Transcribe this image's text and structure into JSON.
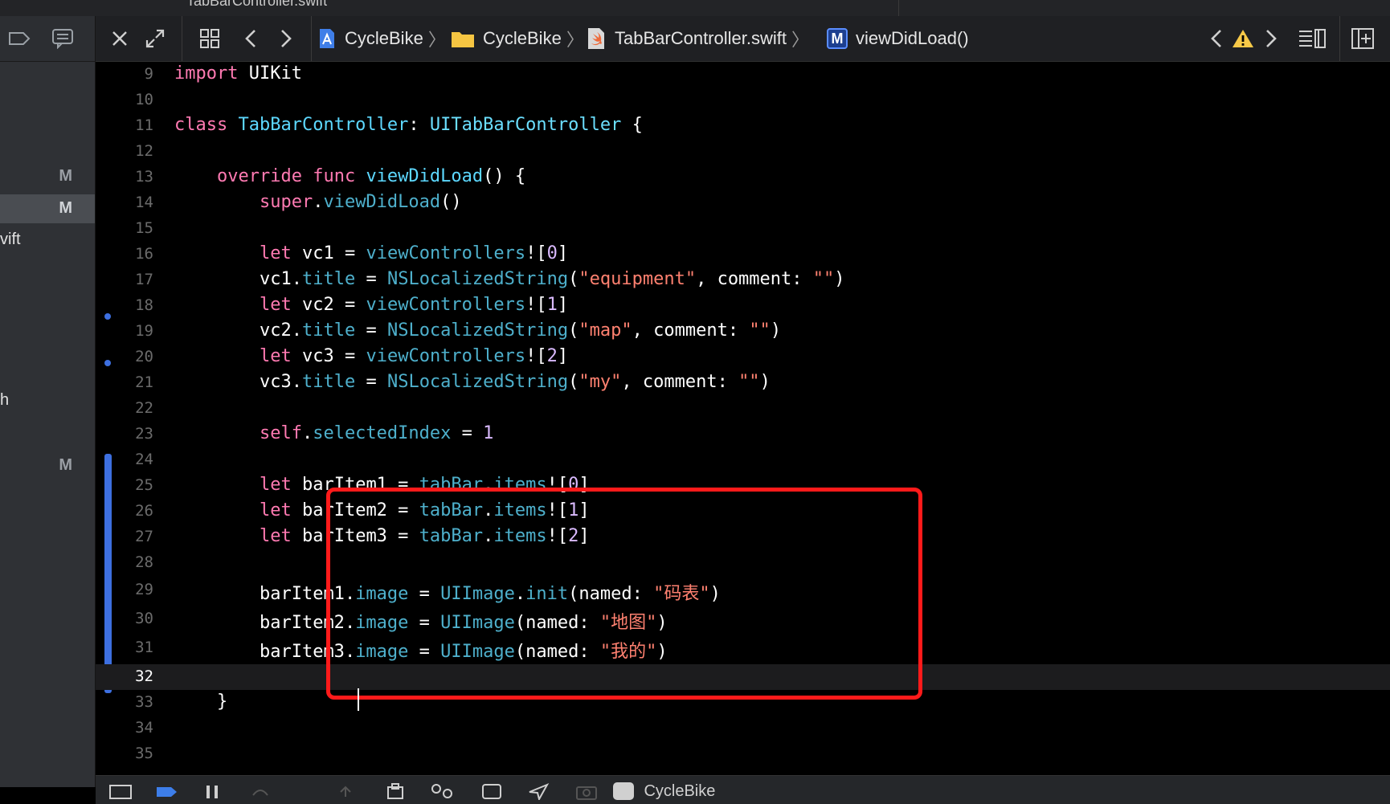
{
  "top_tab": {
    "title": "TabBarController.swift"
  },
  "navigator": {
    "rows": [
      {
        "text": "",
        "badge": "M",
        "selected": false
      },
      {
        "text": "",
        "badge": "M",
        "selected": true
      },
      {
        "text": "vift",
        "badge": "",
        "selected": false
      },
      {
        "text": "h",
        "badge": "",
        "selected": false
      },
      {
        "text": "",
        "badge": "M",
        "selected": false
      }
    ]
  },
  "jumpbar": {
    "project": "CycleBike",
    "folder": "CycleBike",
    "file": "TabBarController.swift",
    "method_badge": "M",
    "method": "viewDidLoad()",
    "warning_icon": "warning-icon"
  },
  "editor": {
    "current_line": 32,
    "lines": [
      {
        "n": "9"
      },
      {
        "n": "10"
      },
      {
        "n": "11"
      },
      {
        "n": "12"
      },
      {
        "n": "13"
      },
      {
        "n": "14"
      },
      {
        "n": "15"
      },
      {
        "n": "16"
      },
      {
        "n": "17"
      },
      {
        "n": "18"
      },
      {
        "n": "19"
      },
      {
        "n": "20"
      },
      {
        "n": "21"
      },
      {
        "n": "22"
      },
      {
        "n": "23"
      },
      {
        "n": "24"
      },
      {
        "n": "25"
      },
      {
        "n": "26"
      },
      {
        "n": "27"
      },
      {
        "n": "28"
      },
      {
        "n": "29"
      },
      {
        "n": "30"
      },
      {
        "n": "31"
      },
      {
        "n": "32"
      },
      {
        "n": "33"
      },
      {
        "n": "34"
      },
      {
        "n": "35"
      }
    ],
    "tokens": {
      "import": "import",
      "uikit": "UIKit",
      "class": "class",
      "tbc_name": "TabBarController",
      "colon": ":",
      "super_cls": "UITabBarController",
      "lbrace": " {",
      "override": "override",
      "func": "func",
      "vdl": "viewDidLoad",
      "paren_brace": "() {",
      "super": "super",
      "dot": ".",
      "vdl_call": "viewDidLoad",
      "parens": "()",
      "let": "let",
      "vc1": "vc1",
      "vc2": "vc2",
      "vc3": "vc3",
      "eq": " = ",
      "viewControllers": "viewControllers",
      "bang_open": "![",
      "close_br": "]",
      "i0": "0",
      "i1": "1",
      "i2": "2",
      "title": "title",
      "nsls": "NSLocalizedString",
      "lp": "(",
      "rp": ")",
      "s_equipment": "\"equipment\"",
      "s_map": "\"map\"",
      "s_my": "\"my\"",
      "comment": ", comment: ",
      "s_empty": "\"\"",
      "self": "self",
      "selectedIndex": "selectedIndex",
      "one": "1",
      "barItem1": "barItem1",
      "barItem2": "barItem2",
      "barItem3": "barItem3",
      "tabBar": "tabBar",
      "items": "items",
      "image": "image",
      "uiimage": "UIImage",
      "init": "init",
      "named": "(named: ",
      "s_mabiao": "\"码表\"",
      "s_ditu": "\"地图\"",
      "s_wode": "\"我的\"",
      "rbrace": "}"
    }
  },
  "debug_bar": {
    "scheme": "CycleBike"
  },
  "colors": {
    "keyword": "#ff7ab2",
    "type": "#5dd8ff",
    "string": "#ff8170",
    "number": "#d9c97c",
    "highlight_box": "#ff1a1a",
    "change_bar": "#3d6fe0"
  }
}
